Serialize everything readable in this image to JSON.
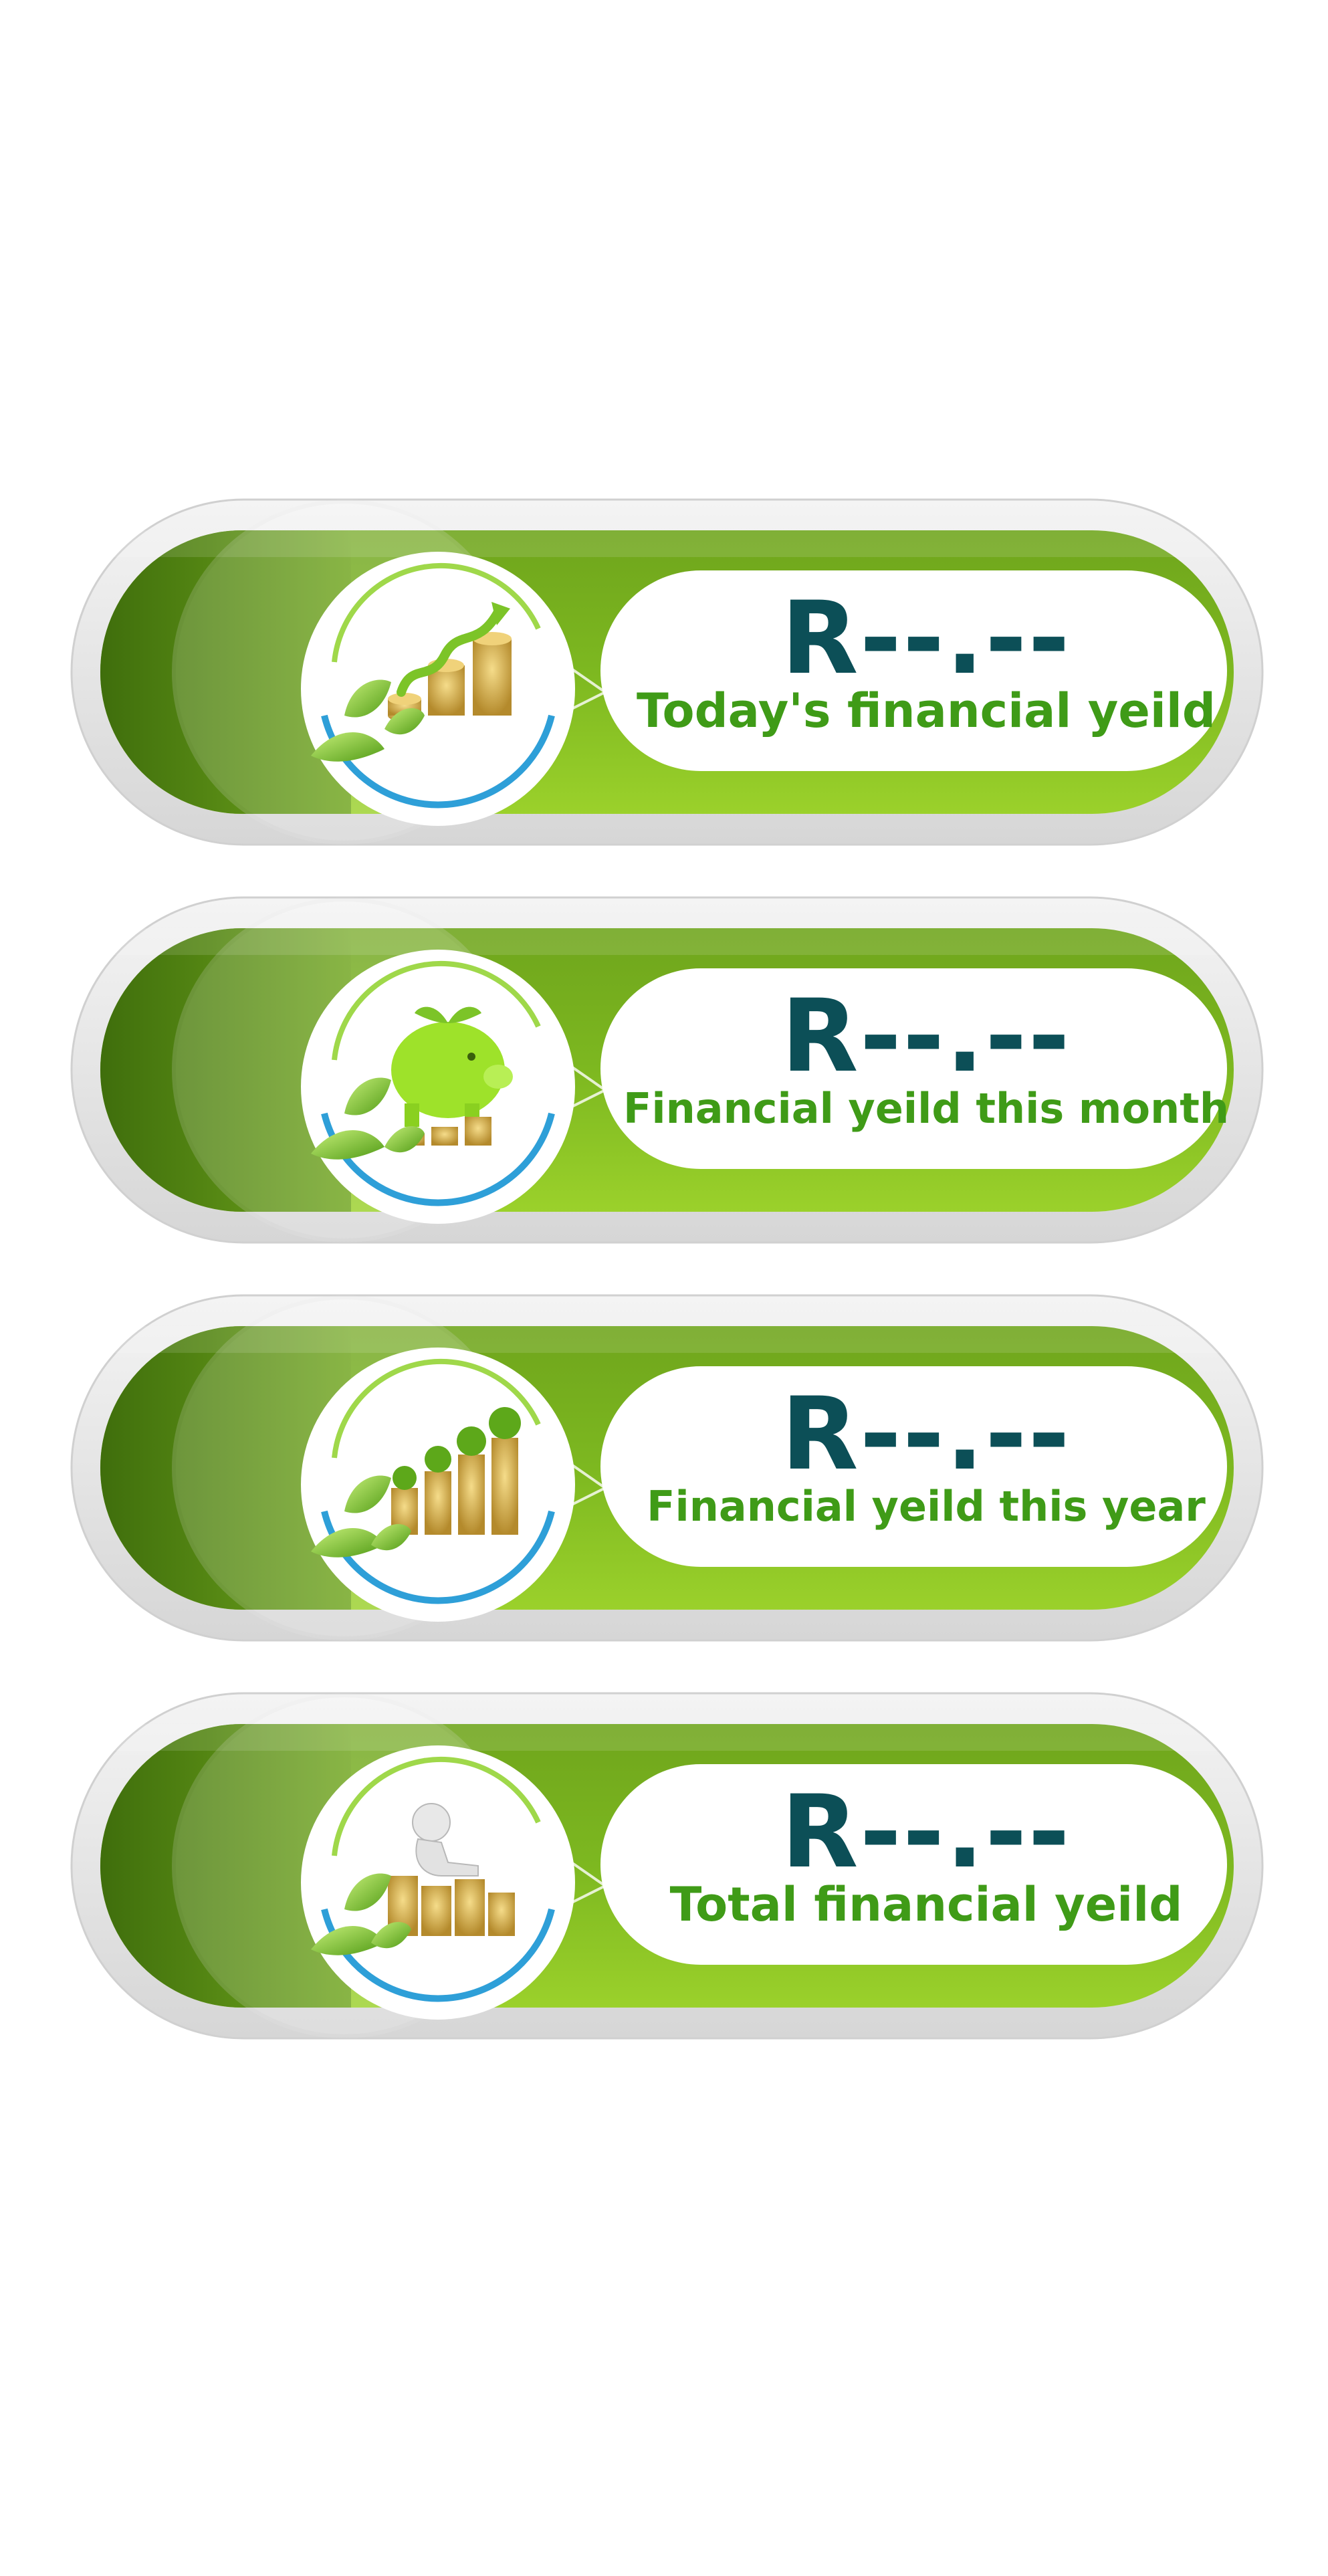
{
  "colors": {
    "value_text": "#0c4f57",
    "label_text": "#3f9b17",
    "band_dark": "#4d7f0f",
    "band_light": "#9bd12b",
    "frame": "#e6e6e6"
  },
  "cards": [
    {
      "value": "R--.--",
      "label": "Today's financial yeild",
      "icon": "growing-coins-chart-icon"
    },
    {
      "value": "R--.--",
      "label": "Financial yeild this month",
      "icon": "piggy-bank-icon"
    },
    {
      "value": "R--.--",
      "label": "Financial yeild this year",
      "icon": "coin-stacks-trees-icon"
    },
    {
      "value": "R--.--",
      "label": "Total financial yeild",
      "icon": "relaxing-person-coins-icon"
    }
  ]
}
